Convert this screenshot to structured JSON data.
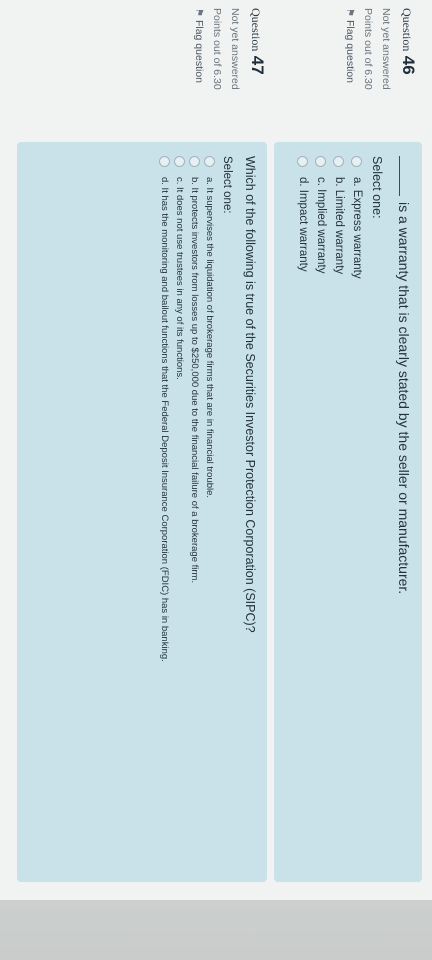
{
  "questions": [
    {
      "number_label": "Question",
      "number": "46",
      "status": "Not yet answered",
      "points": "Points out of 6.30",
      "flag_label": "Flag question",
      "text": "is a warranty that is clearly stated by the seller or manufacturer.",
      "select_label": "Select one:",
      "options": [
        "a. Express warranty",
        "b. Limited warranty",
        "c. Implied warranty",
        "d. Impact warranty"
      ]
    },
    {
      "number_label": "Question",
      "number": "47",
      "status": "Not yet answered",
      "points": "Points out of 6.30",
      "flag_label": "Flag question",
      "text": "Which of the following is true of the Securities Investor Protection Corporation (SIPC)?",
      "select_label": "Select one:",
      "options": [
        "a. It supervises the liquidation of brokerage firms that are in financial trouble.",
        "b. It protects investors from losses up to $250,000 due to the financial failure of a brokerage firm.",
        "c. It does not use trustees in any of its functions.",
        "d. It has the monitoring and bailout functions that the Federal Deposit Insurance Corporation (FDIC) has in banking."
      ]
    }
  ]
}
